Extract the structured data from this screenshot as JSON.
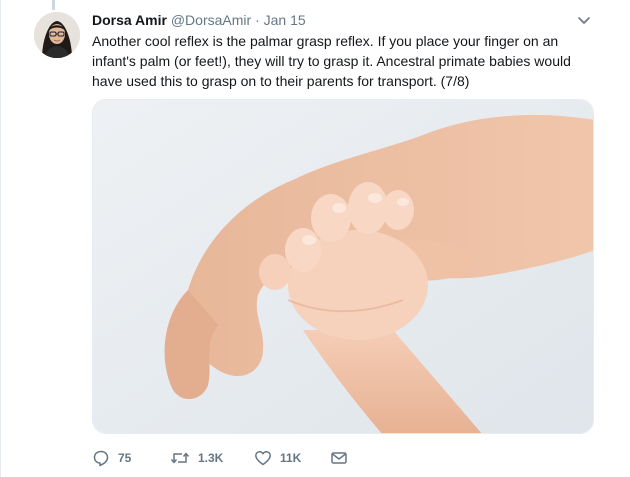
{
  "tweet": {
    "author_name": "Dorsa Amir",
    "handle": "@DorsaAmir",
    "separator": "·",
    "date": "Jan 15",
    "text": "Another cool reflex is the palmar grasp reflex. If you place your finger on an infant's palm (or feet!), they will try to grasp it. Ancestral primate babies would have used this to grasp on to their parents for transport. (7/8)",
    "media_icon": "photo-of-baby-hand-grasping-adult-finger"
  },
  "actions": {
    "reply_icon": "reply-icon",
    "reply_count": "75",
    "retweet_icon": "retweet-icon",
    "retweet_count": "1.3K",
    "like_icon": "heart-icon",
    "like_count": "11K",
    "dm_icon": "envelope-icon"
  },
  "colors": {
    "text_primary": "#14171a",
    "text_secondary": "#657786",
    "border": "#e6ecf0"
  }
}
